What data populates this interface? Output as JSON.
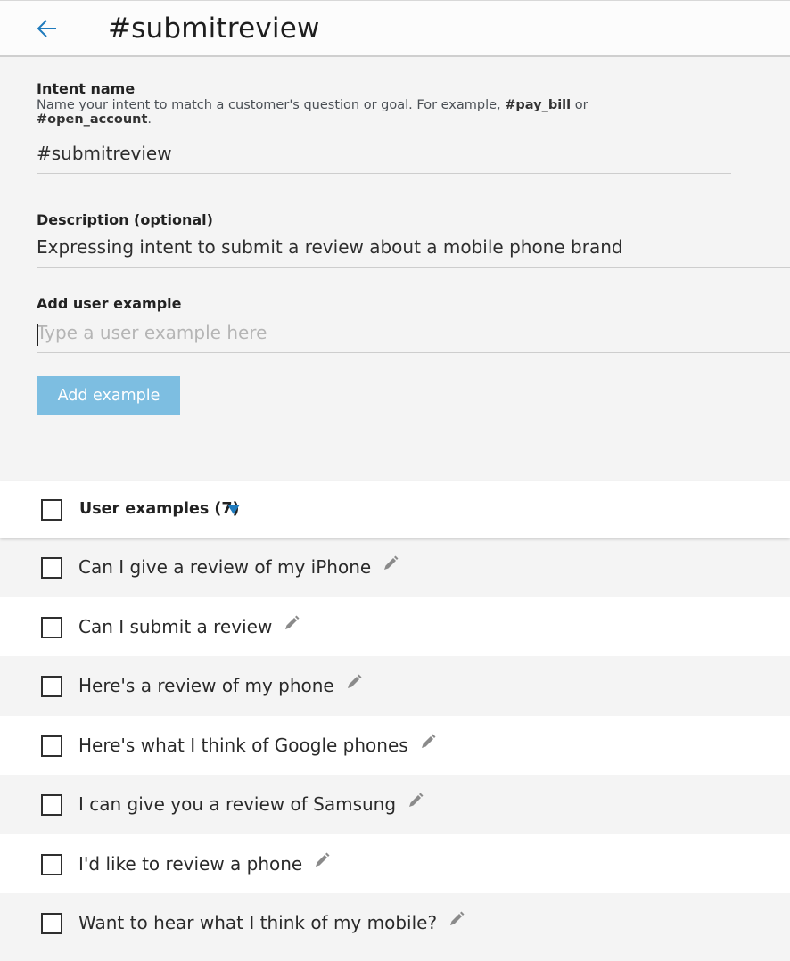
{
  "header": {
    "back_icon": "arrow-left-icon",
    "title": "#submitreview",
    "accent_color": "#1f7bbd"
  },
  "form": {
    "intent_label": "Intent name",
    "intent_helper_prefix": "Name your intent to match a customer's question or goal. For example, ",
    "intent_helper_example1": "#pay_bill",
    "intent_helper_or": " or",
    "intent_helper_example2": "#open_account",
    "intent_helper_end": ".",
    "intent_value": "#submitreview",
    "description_label": "Description (optional)",
    "description_value": "Expressing intent to submit a review about a mobile phone brand",
    "example_label": "Add user example",
    "example_placeholder": "Type a user example here",
    "add_button_label": "Add example"
  },
  "examples": {
    "header_label": "User examples (7)",
    "sort_icon": "caret-down-icon",
    "edit_icon": "pencil-icon",
    "items": [
      "Can I give a review of my iPhone",
      "Can I submit a review",
      "Here's a review of my phone",
      "Here's what I think of Google phones",
      "I can give you a review of Samsung",
      "I'd like to review a phone",
      "Want to hear what I think of my mobile?"
    ]
  }
}
